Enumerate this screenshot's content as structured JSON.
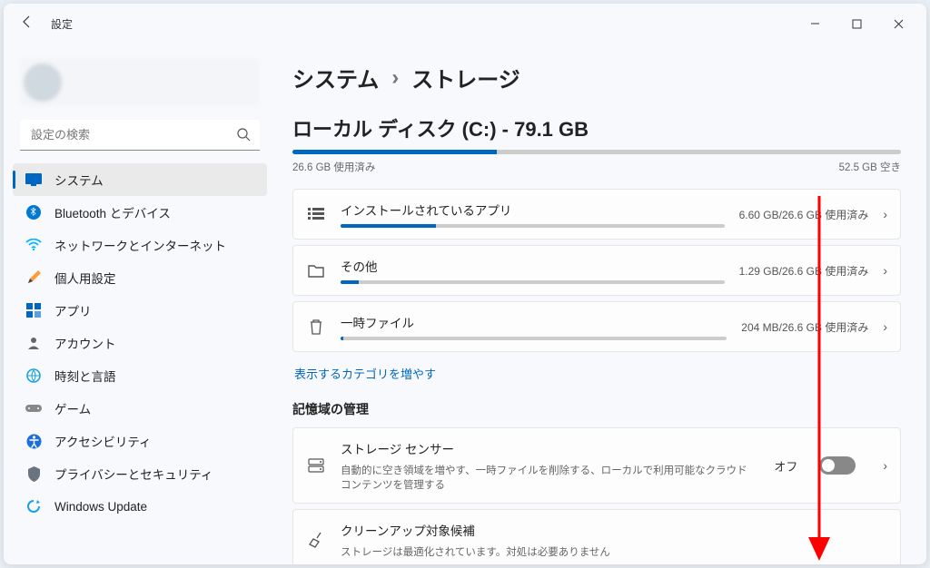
{
  "app": {
    "title": "設定"
  },
  "search": {
    "placeholder": "設定の検索"
  },
  "sidebar": {
    "items": [
      {
        "label": "システム"
      },
      {
        "label": "Bluetooth とデバイス"
      },
      {
        "label": "ネットワークとインターネット"
      },
      {
        "label": "個人用設定"
      },
      {
        "label": "アプリ"
      },
      {
        "label": "アカウント"
      },
      {
        "label": "時刻と言語"
      },
      {
        "label": "ゲーム"
      },
      {
        "label": "アクセシビリティ"
      },
      {
        "label": "プライバシーとセキュリティ"
      },
      {
        "label": "Windows Update"
      }
    ]
  },
  "breadcrumb": {
    "a": "システム",
    "sep": "›",
    "b": "ストレージ"
  },
  "disk": {
    "title": "ローカル ディスク (C:) - 79.1 GB",
    "used_label": "26.6 GB 使用済み",
    "free_label": "52.5 GB 空き",
    "fill_pct": 33.6
  },
  "categories": [
    {
      "title": "インストールされているアプリ",
      "stat": "6.60 GB/26.6 GB 使用済み",
      "fill_pct": 24.8
    },
    {
      "title": "その他",
      "stat": "1.29 GB/26.6 GB 使用済み",
      "fill_pct": 4.8
    },
    {
      "title": "一時ファイル",
      "stat": "204 MB/26.6 GB 使用済み",
      "fill_pct": 0.8
    }
  ],
  "more_link": "表示するカテゴリを増やす",
  "management": {
    "heading": "記憶域の管理",
    "sensor": {
      "title": "ストレージ センサー",
      "desc": "自動的に空き領域を増やす、一時ファイルを削除する、ローカルで利用可能なクラウド コンテンツを管理する",
      "state_label": "オフ"
    },
    "cleanup": {
      "title": "クリーンアップ対象候補",
      "desc": "ストレージは最適化されています。対処は必要ありません"
    }
  }
}
